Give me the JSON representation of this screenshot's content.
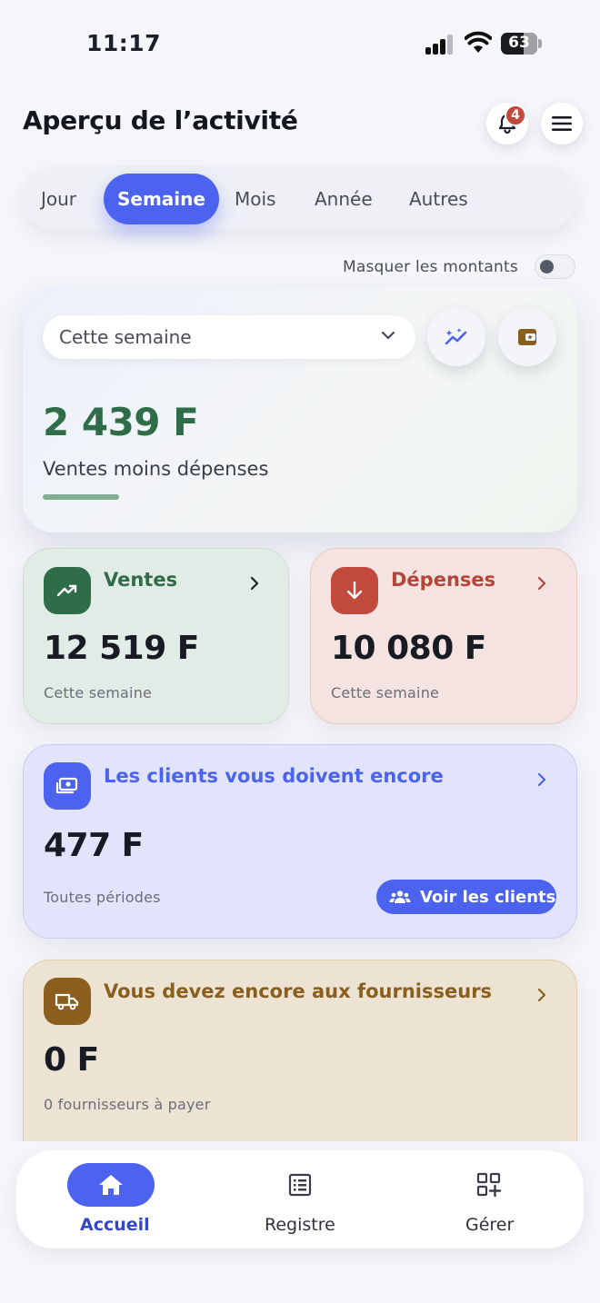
{
  "status_bar": {
    "time": "11:17",
    "battery": "63"
  },
  "header": {
    "title": "Aperçu de l’activité",
    "notification_count": "4"
  },
  "period_tabs": [
    {
      "label": "Jour",
      "active": false
    },
    {
      "label": "Semaine",
      "active": true
    },
    {
      "label": "Mois",
      "active": false
    },
    {
      "label": "Année",
      "active": false
    },
    {
      "label": "Autres",
      "active": false
    }
  ],
  "mask_amounts": {
    "label": "Masquer les montants",
    "enabled": false
  },
  "summary": {
    "period_select": "Cette semaine",
    "net_amount": "2 439 F",
    "net_label": "Ventes moins dépenses"
  },
  "sales": {
    "title": "Ventes",
    "amount": "12 519 F",
    "period": "Cette semaine"
  },
  "expenses": {
    "title": "Dépenses",
    "amount": "10 080 F",
    "period": "Cette semaine"
  },
  "clients": {
    "title": "Les clients vous doivent encore",
    "amount": "477 F",
    "period": "Toutes périodes",
    "button_label": "Voir les clients"
  },
  "suppliers": {
    "title": "Vous devez encore aux fournisseurs",
    "amount": "0 F",
    "subtitle": "0 fournisseurs à payer"
  },
  "bottom_nav": [
    {
      "label": "Accueil",
      "icon": "home-icon",
      "active": true
    },
    {
      "label": "Registre",
      "icon": "list-icon",
      "active": false
    },
    {
      "label": "Gérer",
      "icon": "grid-plus-icon",
      "active": false
    }
  ],
  "colors": {
    "accent": "#4c63f0",
    "positive": "#2e6d47",
    "expense": "#c14a3c",
    "supplier": "#8a5f1e"
  }
}
